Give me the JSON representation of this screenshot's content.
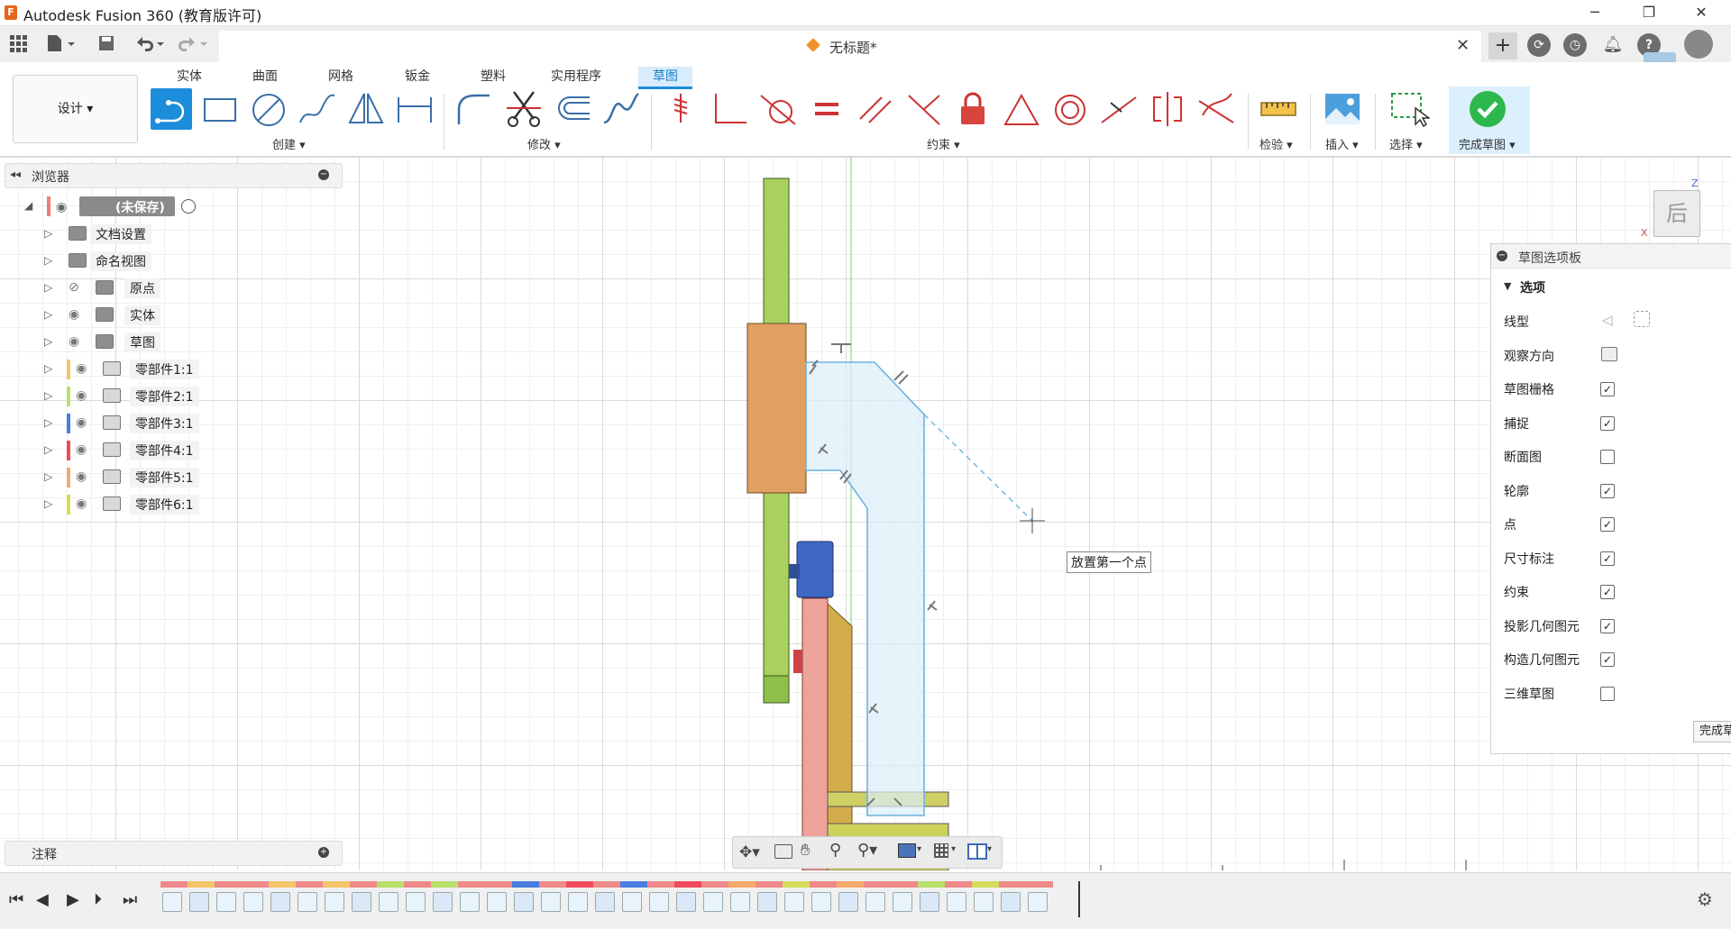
{
  "app": {
    "title": "Autodesk Fusion 360 (教育版许可)",
    "logo_letter": "F"
  },
  "window": {
    "minimize": "─",
    "restore": "❐",
    "close": "✕"
  },
  "document": {
    "title": "无标题*",
    "close": "✕",
    "new_tab": "+"
  },
  "ribbon": {
    "design_label": "设计 ▾",
    "tabs": [
      "实体",
      "曲面",
      "网格",
      "钣金",
      "塑料",
      "实用程序",
      "草图"
    ],
    "active_tab": "草图",
    "groups": {
      "create": "创建 ▾",
      "modify": "修改 ▾",
      "constraints": "约束 ▾",
      "inspect": "检验 ▾",
      "insert": "插入 ▾",
      "select": "选择 ▾",
      "finish": "完成草图 ▾"
    }
  },
  "browser": {
    "title": "浏览器",
    "root": "(未保存)",
    "items": [
      {
        "label": "文档设置",
        "icon": "gear-icon"
      },
      {
        "label": "命名视图",
        "icon": "folder-icon"
      },
      {
        "label": "原点",
        "icon": "folder-icon"
      },
      {
        "label": "实体",
        "icon": "folder-icon"
      },
      {
        "label": "草图",
        "icon": "folder-icon"
      },
      {
        "label": "零部件1:1",
        "color": "#f5c56b"
      },
      {
        "label": "零部件2:1",
        "color": "#b8e06b"
      },
      {
        "label": "零部件3:1",
        "color": "#4a7de0"
      },
      {
        "label": "零部件4:1",
        "color": "#f04a5a"
      },
      {
        "label": "零部件5:1",
        "color": "#f5a96b"
      },
      {
        "label": "零部件6:1",
        "color": "#d6dc5a"
      }
    ]
  },
  "viewcube": {
    "face": "后",
    "axis_z": "Z",
    "axis_x": "X"
  },
  "canvas": {
    "tooltip": "放置第一个点"
  },
  "palette": {
    "title": "草图选项板",
    "section": "选项",
    "rows": [
      {
        "label": "线型",
        "control": "icons"
      },
      {
        "label": "观察方向",
        "control": "icon"
      },
      {
        "label": "草图栅格",
        "checked": true
      },
      {
        "label": "捕捉",
        "checked": true
      },
      {
        "label": "断面图",
        "checked": false
      },
      {
        "label": "轮廓",
        "checked": true
      },
      {
        "label": "点",
        "checked": true
      },
      {
        "label": "尺寸标注",
        "checked": true
      },
      {
        "label": "约束",
        "checked": true
      },
      {
        "label": "投影几何图元",
        "checked": true
      },
      {
        "label": "构造几何图元",
        "checked": true
      },
      {
        "label": "三维草图",
        "checked": false
      }
    ],
    "finish_button": "完成草"
  },
  "notes": {
    "title": "注释"
  },
  "colors": {
    "accent": "#1c8ddb",
    "finish_green": "#2db84d"
  }
}
